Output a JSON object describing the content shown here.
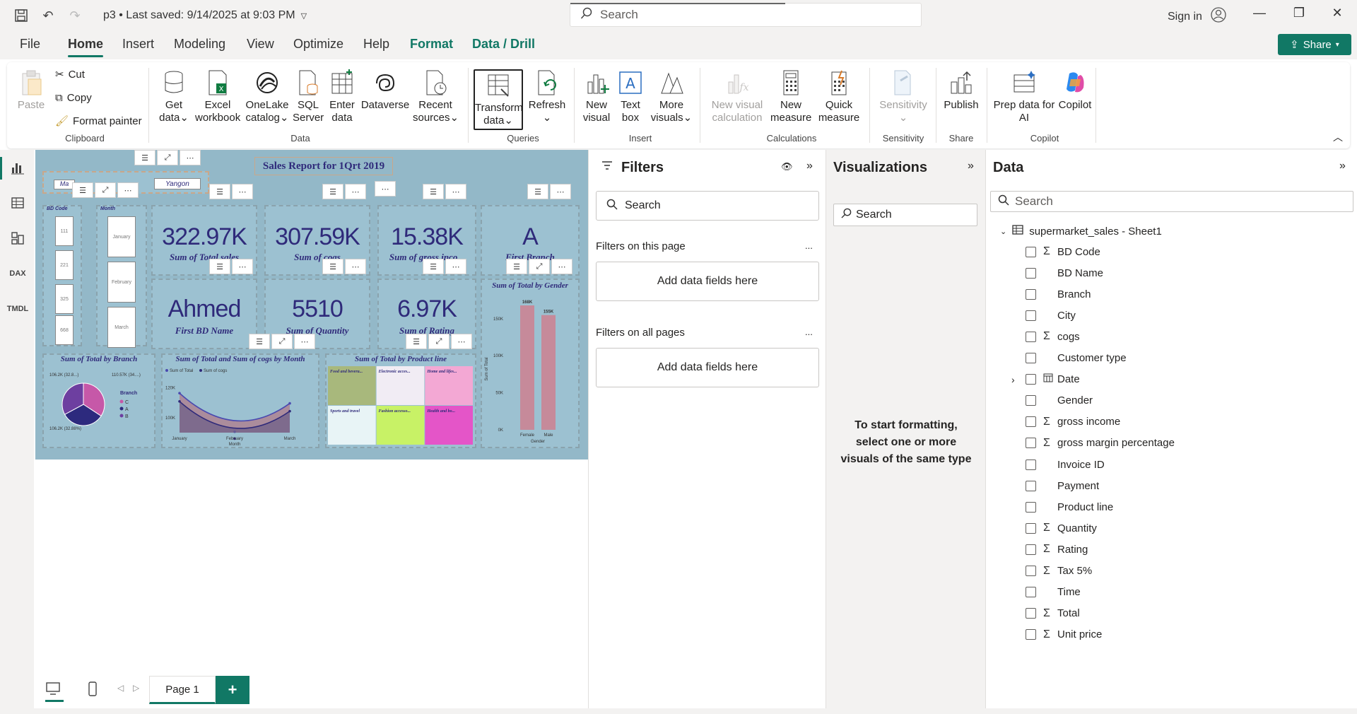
{
  "titlebar": {
    "doc_title": "p3 • Last saved: 9/14/2025 at 9:03 PM",
    "search_placeholder": "Search",
    "sign_in": "Sign in"
  },
  "menu": {
    "items": [
      "File",
      "Home",
      "Insert",
      "Modeling",
      "View",
      "Optimize",
      "Help",
      "Format",
      "Data / Drill"
    ],
    "share": "Share"
  },
  "ribbon": {
    "clipboard": {
      "paste": "Paste",
      "cut": "Cut",
      "copy": "Copy",
      "format_painter": "Format painter",
      "label": "Clipboard"
    },
    "data": {
      "get_data": "Get data",
      "excel": "Excel workbook",
      "onelake": "OneLake catalog",
      "sql": "SQL Server",
      "enter": "Enter data",
      "dataverse": "Dataverse",
      "recent": "Recent sources",
      "label": "Data"
    },
    "queries": {
      "transform": "Transform data",
      "refresh": "Refresh",
      "label": "Queries"
    },
    "insert": {
      "new_visual": "New visual",
      "text_box": "Text box",
      "more_visuals": "More visuals",
      "label": "Insert"
    },
    "calculations": {
      "new_visual_calc": "New visual calculation",
      "new_measure": "New measure",
      "quick_measure": "Quick measure",
      "label": "Calculations"
    },
    "sensitivity": {
      "sensitivity": "Sensitivity",
      "label": "Sensitivity"
    },
    "share": {
      "publish": "Publish",
      "label": "Share"
    },
    "copilot": {
      "prep": "Prep data for AI",
      "copilot": "Copilot",
      "label": "Copilot"
    }
  },
  "report": {
    "title": "Sales Report for 1Qrt 2019",
    "branch_slicer": [
      "Ma",
      "Yangon"
    ],
    "bd_code_header": "BD Code",
    "bd_codes": [
      "111",
      "221",
      "325",
      "668"
    ],
    "month_header": "Month",
    "months": [
      "January",
      "February",
      "March"
    ],
    "kpis": [
      {
        "value": "322.97K",
        "label": "Sum of Total sales"
      },
      {
        "value": "307.59K",
        "label": "Sum of cogs"
      },
      {
        "value": "15.38K",
        "label": "Sum of gross inco..."
      },
      {
        "value": "A",
        "label": "First Branch"
      },
      {
        "value": "Ahmed",
        "label": "First BD Name"
      },
      {
        "value": "5510",
        "label": "Sum of Quantity"
      },
      {
        "value": "6.97K",
        "label": "Sum of Rating"
      }
    ],
    "pie_title": "Sum of Total by Branch",
    "pie_legend_title": "Branch",
    "line_title": "Sum of Total and Sum of cogs by Month",
    "treemap_title": "Sum of Total by Product line",
    "gender_title": "Sum of Total by Gender"
  },
  "chart_data": [
    {
      "type": "pie",
      "title": "Sum of Total by Branch",
      "categories": [
        "C",
        "A",
        "B"
      ],
      "values": [
        110.6,
        106.2,
        106.2
      ],
      "data_labels": [
        "110.57K (34....)",
        "106.2K (32.8...)",
        "106.2K (32.88%)"
      ],
      "colors": [
        "#c658a8",
        "#2d2a7e",
        "#6d3fa0"
      ],
      "legend": "right"
    },
    {
      "type": "line",
      "title": "Sum of Total and Sum of cogs by Month",
      "categories": [
        "January",
        "February",
        "March"
      ],
      "series": [
        {
          "name": "Sum of Total",
          "values": [
            116.3,
            97.2,
            109.5
          ]
        },
        {
          "name": "Sum of cogs",
          "values": [
            110.8,
            92.6,
            104.3
          ]
        }
      ],
      "y_ticks": [
        "100K",
        "120K"
      ],
      "xlabel": "Month",
      "legend": "top-left"
    },
    {
      "type": "heatmap",
      "title": "Sum of Total by Product line",
      "categories": [
        "Food and bevera...",
        "Electronic acces...",
        "Home and lifes...",
        "Sports and travel",
        "Fashion accesso...",
        "Health and bo..."
      ],
      "colors": [
        "#a8b87c",
        "#f1ecf4",
        "#f3a8d4",
        "#e8f4f6",
        "#c8f266",
        "#e455c8"
      ]
    },
    {
      "type": "bar",
      "title": "Sum of Total by Gender",
      "categories": [
        "Female",
        "Male"
      ],
      "values": [
        168,
        155
      ],
      "data_labels": [
        "168K",
        "155K"
      ],
      "y_ticks": [
        "0K",
        "50K",
        "100K",
        "150K"
      ],
      "ylim": [
        0,
        168
      ],
      "xlabel": "Gender",
      "ylabel": "Sum of Total"
    }
  ],
  "filters": {
    "title": "Filters",
    "search": "Search",
    "on_page": "Filters on this page",
    "on_all": "Filters on all pages",
    "add_fields": "Add data fields here",
    "more": "..."
  },
  "visualizations": {
    "title": "Visualizations",
    "search": "Search",
    "hint": "To start formatting, select one or more visuals of the same type"
  },
  "data_pane": {
    "title": "Data",
    "search": "Search",
    "table": "supermarket_sales - Sheet1",
    "fields": [
      {
        "name": "BD Code",
        "sigma": true
      },
      {
        "name": "BD Name",
        "sigma": false
      },
      {
        "name": "Branch",
        "sigma": false
      },
      {
        "name": "City",
        "sigma": false
      },
      {
        "name": "cogs",
        "sigma": true
      },
      {
        "name": "Customer type",
        "sigma": false
      },
      {
        "name": "Date",
        "sigma": false,
        "date": true
      },
      {
        "name": "Gender",
        "sigma": false
      },
      {
        "name": "gross income",
        "sigma": true
      },
      {
        "name": "gross margin percentage",
        "sigma": true
      },
      {
        "name": "Invoice ID",
        "sigma": false
      },
      {
        "name": "Payment",
        "sigma": false
      },
      {
        "name": "Product line",
        "sigma": false
      },
      {
        "name": "Quantity",
        "sigma": true
      },
      {
        "name": "Rating",
        "sigma": true
      },
      {
        "name": "Tax 5%",
        "sigma": true
      },
      {
        "name": "Time",
        "sigma": false
      },
      {
        "name": "Total",
        "sigma": true
      },
      {
        "name": "Unit price",
        "sigma": true
      }
    ]
  },
  "pages": {
    "page1": "Page 1",
    "add": "+"
  }
}
